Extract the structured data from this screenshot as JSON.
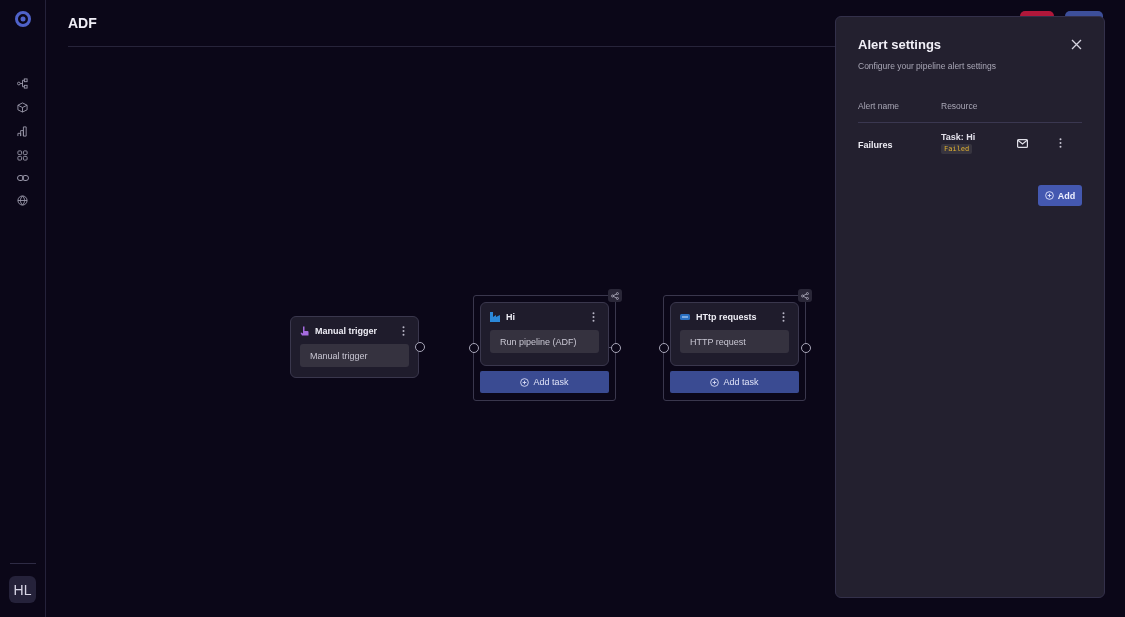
{
  "sidebar": {
    "avatar": "HL"
  },
  "header": {
    "title": "ADF"
  },
  "canvas": {
    "nodes": [
      {
        "kind": "trigger",
        "title": "Manual trigger",
        "step": "Manual trigger"
      },
      {
        "kind": "adf",
        "title": "Hi",
        "step": "Run pipeline (ADF)",
        "add_label": "Add task"
      },
      {
        "kind": "http",
        "title": "HTtp requests",
        "step": "HTTP request",
        "add_label": "Add task"
      }
    ]
  },
  "alert_panel": {
    "title": "Alert settings",
    "subtitle": "Configure your pipeline alert settings",
    "columns": [
      "Alert name",
      "Resource"
    ],
    "rows": [
      {
        "name": "Failures",
        "resource": "Task: Hi",
        "status": "Failed"
      }
    ],
    "add_label": "Add"
  }
}
